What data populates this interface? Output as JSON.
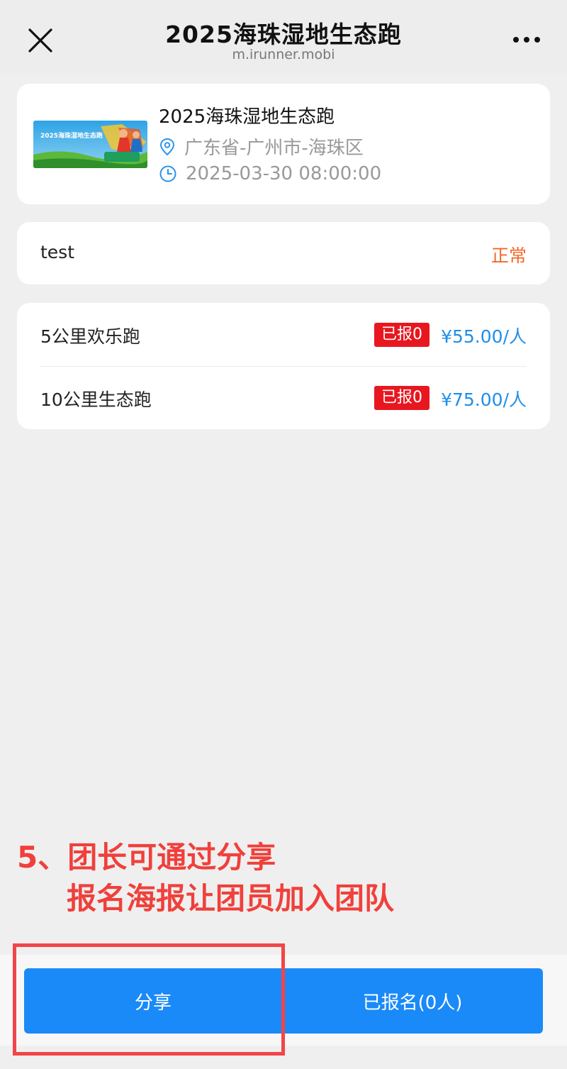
{
  "header": {
    "title": "2025海珠湿地生态跑",
    "subtitle": "m.irunner.mobi"
  },
  "event": {
    "name": "2025海珠湿地生态跑",
    "location": "广东省-广州市-海珠区",
    "datetime": "2025-03-30 08:00:00",
    "banner_title": "2025海珠湿地生态跑"
  },
  "team": {
    "name": "test",
    "status": "正常",
    "status_color": "#f2692a"
  },
  "races": [
    {
      "name": "5公里欢乐跑",
      "badge": "已报0",
      "price": "¥55.00/人"
    },
    {
      "name": "10公里生态跑",
      "badge": "已报0",
      "price": "¥75.00/人"
    }
  ],
  "annotation": {
    "line1": "5、团长可通过分享",
    "line2": "报名海报让团员加入团队",
    "color": "#f0403b"
  },
  "actions": {
    "share_label": "分享",
    "registered_label": "已报名(0人)"
  },
  "colors": {
    "primary": "#1a8af8",
    "badge": "#e8171f",
    "price": "#1f8ee8"
  },
  "icons": {
    "close": "close-icon",
    "more": "more-icon",
    "location": "location-pin-icon",
    "time": "clock-icon"
  }
}
